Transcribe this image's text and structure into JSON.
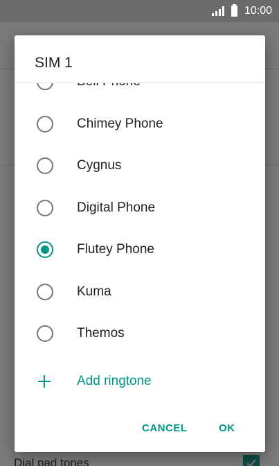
{
  "status_bar": {
    "time": "10:00",
    "icons": [
      "signal-icon",
      "battery-icon"
    ]
  },
  "background": {
    "row_label": "Dial pad tones",
    "checkbox_checked": true
  },
  "dialog": {
    "title": "SIM 1",
    "options": [
      {
        "label": "Bell Phone",
        "selected": false
      },
      {
        "label": "Chimey Phone",
        "selected": false
      },
      {
        "label": "Cygnus",
        "selected": false
      },
      {
        "label": "Digital Phone",
        "selected": false
      },
      {
        "label": "Flutey Phone",
        "selected": true
      },
      {
        "label": "Kuma",
        "selected": false
      },
      {
        "label": "Themos",
        "selected": false
      }
    ],
    "add_label": "Add ringtone",
    "cancel_label": "CANCEL",
    "ok_label": "OK"
  },
  "colors": {
    "accent": "#009688",
    "scrim": "#7a7a7a"
  }
}
